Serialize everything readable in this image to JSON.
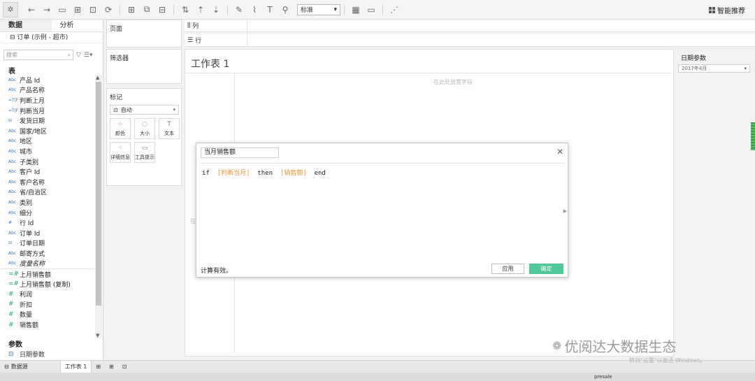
{
  "toolbar": {
    "icons": [
      "tableau-logo-icon",
      "back-icon",
      "forward-icon",
      "save-icon",
      "new-datasource-icon",
      "pause-icon",
      "refresh-icon",
      "new-sheet-icon",
      "duplicate-icon",
      "clear-icon",
      "swap-icon",
      "sort-asc-icon",
      "sort-desc-icon",
      "highlight-icon",
      "group-icon",
      "label-icon",
      "fix-axes-icon",
      "pin-icon",
      "chart-icon",
      "present-icon",
      "share-icon"
    ],
    "fit_select": "标准",
    "show_me": "智能推荐"
  },
  "left": {
    "tab_data": "数据",
    "tab_analysis": "分析",
    "datasource": "订单 (示例 - 超市)",
    "search_placeholder": "搜索",
    "tables_title": "表",
    "fields": [
      {
        "type": "Abc",
        "name": "产品 Id",
        "kind": "dim"
      },
      {
        "type": "Abc",
        "name": "产品名称",
        "kind": "dim"
      },
      {
        "type": "=T|F",
        "name": "判断上月",
        "kind": "dim"
      },
      {
        "type": "=T|F",
        "name": "判断当月",
        "kind": "dim"
      },
      {
        "type": "⊟",
        "name": "发货日期",
        "kind": "dim"
      },
      {
        "type": "Abc",
        "name": "国家/地区",
        "kind": "dim"
      },
      {
        "type": "Abc",
        "name": "地区",
        "kind": "dim"
      },
      {
        "type": "Abc",
        "name": "城市",
        "kind": "dim"
      },
      {
        "type": "Abc",
        "name": "子类别",
        "kind": "dim"
      },
      {
        "type": "Abc",
        "name": "客户 Id",
        "kind": "dim"
      },
      {
        "type": "Abc",
        "name": "客户名称",
        "kind": "dim"
      },
      {
        "type": "Abc",
        "name": "省/自治区",
        "kind": "dim"
      },
      {
        "type": "Abc",
        "name": "类别",
        "kind": "dim"
      },
      {
        "type": "Abc",
        "name": "细分",
        "kind": "dim"
      },
      {
        "type": "#",
        "name": "行 Id",
        "kind": "dim"
      },
      {
        "type": "Abc",
        "name": "订单 Id",
        "kind": "dim"
      },
      {
        "type": "⊟",
        "name": "订单日期",
        "kind": "dim"
      },
      {
        "type": "Abc",
        "name": "邮寄方式",
        "kind": "dim"
      },
      {
        "type": "Abc",
        "name": "度量名称",
        "kind": "dim"
      },
      {
        "type": "=#",
        "name": "上月销售额",
        "kind": "m"
      },
      {
        "type": "=#",
        "name": "上月销售额 (复制)",
        "kind": "m"
      },
      {
        "type": "#",
        "name": "利润",
        "kind": "m"
      },
      {
        "type": "#",
        "name": "折扣",
        "kind": "m"
      },
      {
        "type": "#",
        "name": "数量",
        "kind": "m"
      },
      {
        "type": "#",
        "name": "销售额",
        "kind": "m"
      }
    ],
    "params_title": "参数",
    "param_item": "日期参数"
  },
  "shelves": {
    "pages": "页面",
    "filters": "筛选器",
    "marks": "标记",
    "marks_type": "自动",
    "color": "颜色",
    "size": "大小",
    "text": "文本",
    "detail": "详细信息",
    "tooltip": "工具提示",
    "columns": "列",
    "rows": "行"
  },
  "canvas": {
    "title": "工作表 1",
    "drop_hint": "在此处放置字段",
    "left_hint": "在"
  },
  "right": {
    "param_title": "日期参数",
    "param_value": "2017年4月"
  },
  "dialog": {
    "name": "当月销售额",
    "code_if": "if",
    "field1": "[判断当月]",
    "code_then": "then",
    "field2": "[销售额]",
    "code_end": "end",
    "status": "计算有效。",
    "apply": "应用",
    "ok": "确定"
  },
  "bottom": {
    "datasource_tab": "数据源",
    "sheet_tab": "工作表 1",
    "taskbar_label": "presale"
  },
  "watermark": {
    "text": "优阅达大数据生态",
    "windows": "转到\"设置\"以激活 Windows。"
  },
  "colors": {
    "ok_button": "#4fc99a",
    "field_orange": "#e59a3b",
    "measure_green": "#2aa57a",
    "dimension_blue": "#3a78b5"
  }
}
